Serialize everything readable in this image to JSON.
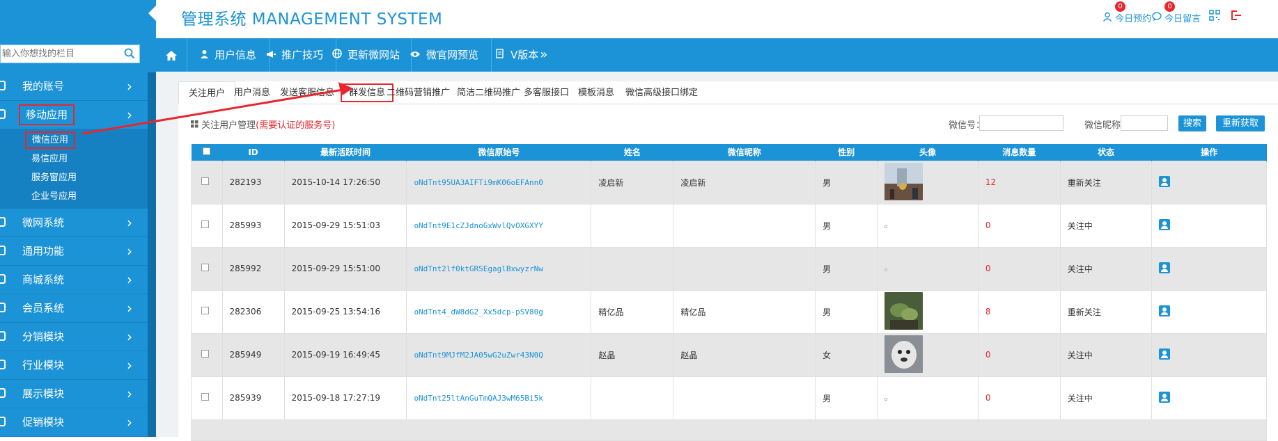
{
  "app": {
    "title": "管理系统 MANAGEMENT SYSTEM"
  },
  "header": {
    "reservations": {
      "label": "今日预约",
      "count": "0"
    },
    "messages": {
      "label": "今日留言",
      "count": "0"
    }
  },
  "sidebar": {
    "search_placeholder": "输入你想找的栏目",
    "items": [
      {
        "label": "我的账号"
      },
      {
        "label": "移动应用"
      },
      {
        "label": "微网系统"
      },
      {
        "label": "通用功能"
      },
      {
        "label": "商城系统"
      },
      {
        "label": "会员系统"
      },
      {
        "label": "分销模块"
      },
      {
        "label": "行业模块"
      },
      {
        "label": "展示模块"
      },
      {
        "label": "促销模块"
      }
    ],
    "sub_items": [
      {
        "label": "微信应用"
      },
      {
        "label": "易信应用"
      },
      {
        "label": "服务窗应用"
      },
      {
        "label": "企业号应用"
      }
    ]
  },
  "nav": {
    "items": [
      {
        "label": "用户信息"
      },
      {
        "label": "推广技巧"
      },
      {
        "label": "更新微网站"
      },
      {
        "label": "微官网预览"
      },
      {
        "label": "V版本"
      }
    ]
  },
  "tabs": [
    {
      "label": "关注用户"
    },
    {
      "label": "用户消息"
    },
    {
      "label": "发送客服信息"
    },
    {
      "label": "群发信息"
    },
    {
      "label": "二维码营销推广"
    },
    {
      "label": "简洁二维码推广"
    },
    {
      "label": "多客服接口"
    },
    {
      "label": "模板消息"
    },
    {
      "label": "微信高级接口绑定"
    }
  ],
  "section": {
    "title": "关注用户管理",
    "note": "(需要认证的服务号)",
    "wx_id_label": "微信号：",
    "wx_nick_label": "微信昵称：",
    "search_btn": "搜索",
    "refresh_btn": "重新获取"
  },
  "table": {
    "headers": [
      "ID",
      "最新活跃时间",
      "微信原始号",
      "姓名",
      "微信昵称",
      "性别",
      "头像",
      "消息数量",
      "状态",
      "操作"
    ],
    "rows": [
      {
        "id": "282193",
        "time": "2015-10-14 17:26:50",
        "wxid": "oNdTnt95UA3AIFTi9mK06oEFAnn0",
        "name": "凌启新",
        "nick": "凌启新",
        "gender": "男",
        "msgs": "12",
        "status": "重新关注",
        "avatar": "city"
      },
      {
        "id": "285993",
        "time": "2015-09-29 15:51:03",
        "wxid": "oNdTnt9E1cZJdnoGxWvlQvOXGXYY",
        "name": "",
        "nick": "",
        "gender": "男",
        "msgs": "0",
        "status": "关注中",
        "avatar": "none"
      },
      {
        "id": "285992",
        "time": "2015-09-29 15:51:00",
        "wxid": "oNdTnt2lf0ktGRSEgaglBxwyzrNw",
        "name": "",
        "nick": "",
        "gender": "男",
        "msgs": "0",
        "status": "关注中",
        "avatar": "none"
      },
      {
        "id": "282306",
        "time": "2015-09-25 13:54:16",
        "wxid": "oNdTnt4_dW8dG2_Xx5dcp-pSV80g",
        "name": "精亿品",
        "nick": "精亿品",
        "gender": "男",
        "msgs": "8",
        "status": "重新关注",
        "avatar": "plant"
      },
      {
        "id": "285949",
        "time": "2015-09-19 16:49:45",
        "wxid": "oNdTnt9MJfM2JA05wG2uZwr43N0Q",
        "name": "赵晶",
        "nick": "赵晶",
        "gender": "女",
        "msgs": "0",
        "status": "关注中",
        "avatar": "dog"
      },
      {
        "id": "285939",
        "time": "2015-09-18 17:27:19",
        "wxid": "oNdTnt25ltAnGuTmQAJ3wM65Bi5k",
        "name": "",
        "nick": "",
        "gender": "男",
        "msgs": "0",
        "status": "关注中",
        "avatar": "none"
      }
    ]
  }
}
